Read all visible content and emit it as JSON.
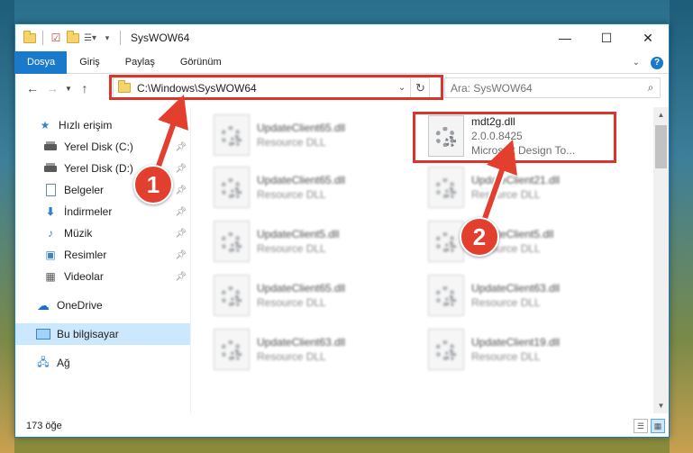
{
  "window": {
    "title": "SysWOW64",
    "controls": {
      "minimize": "—",
      "maximize": "☐",
      "close": "✕"
    }
  },
  "ribbon": {
    "tabs": [
      {
        "label": "Dosya",
        "active": true
      },
      {
        "label": "Giriş"
      },
      {
        "label": "Paylaş"
      },
      {
        "label": "Görünüm"
      }
    ],
    "collapse_icon": "chevron-down-icon",
    "help_label": "?"
  },
  "nav": {
    "address": "C:\\Windows\\SysWOW64",
    "search_placeholder": "Ara: SysWOW64"
  },
  "sidebar": {
    "items": [
      {
        "label": "Hızlı erişim",
        "icon": "star-icon",
        "pinned": false
      },
      {
        "label": "Yerel Disk (C:)",
        "icon": "drive-icon",
        "pinned": true
      },
      {
        "label": "Yerel Disk (D:)",
        "icon": "drive-icon",
        "pinned": true
      },
      {
        "label": "Belgeler",
        "icon": "documents-icon",
        "pinned": true
      },
      {
        "label": "İndirmeler",
        "icon": "download-icon",
        "pinned": true
      },
      {
        "label": "Müzik",
        "icon": "music-icon",
        "pinned": true
      },
      {
        "label": "Resimler",
        "icon": "pictures-icon",
        "pinned": true
      },
      {
        "label": "Videolar",
        "icon": "videos-icon",
        "pinned": true
      },
      {
        "label": "OneDrive",
        "icon": "cloud-icon",
        "pinned": false
      },
      {
        "label": "Bu bilgisayar",
        "icon": "computer-icon",
        "pinned": false,
        "selected": true
      },
      {
        "label": "Ağ",
        "icon": "network-icon",
        "pinned": false
      }
    ]
  },
  "files": {
    "left": [
      {
        "name": "UpdateClient65.dll",
        "sub": "Resource DLL"
      },
      {
        "name": "UpdateClient65.dll",
        "sub": "Resource DLL"
      },
      {
        "name": "UpdateClient5.dll",
        "sub": "Resource DLL"
      },
      {
        "name": "UpdateClient65.dll",
        "sub": "Resource DLL"
      },
      {
        "name": "UpdateClient63.dll",
        "sub": "Resource DLL"
      }
    ],
    "right": [
      {
        "name": "mdt2g.dll",
        "sub": "2.0.0.8425",
        "sub2": "Microsoft Design To..."
      },
      {
        "name": "UpdateClient21.dll",
        "sub": "Resource DLL"
      },
      {
        "name": "UpdateClient5.dll",
        "sub": "Resource DLL"
      },
      {
        "name": "UpdateClient63.dll",
        "sub": "Resource DLL"
      },
      {
        "name": "UpdateClient19.dll",
        "sub": "Resource DLL"
      }
    ]
  },
  "status": {
    "count": "173 öğe"
  },
  "annotations": {
    "step1": "1",
    "step2": "2",
    "highlight_color": "#d9352b"
  }
}
